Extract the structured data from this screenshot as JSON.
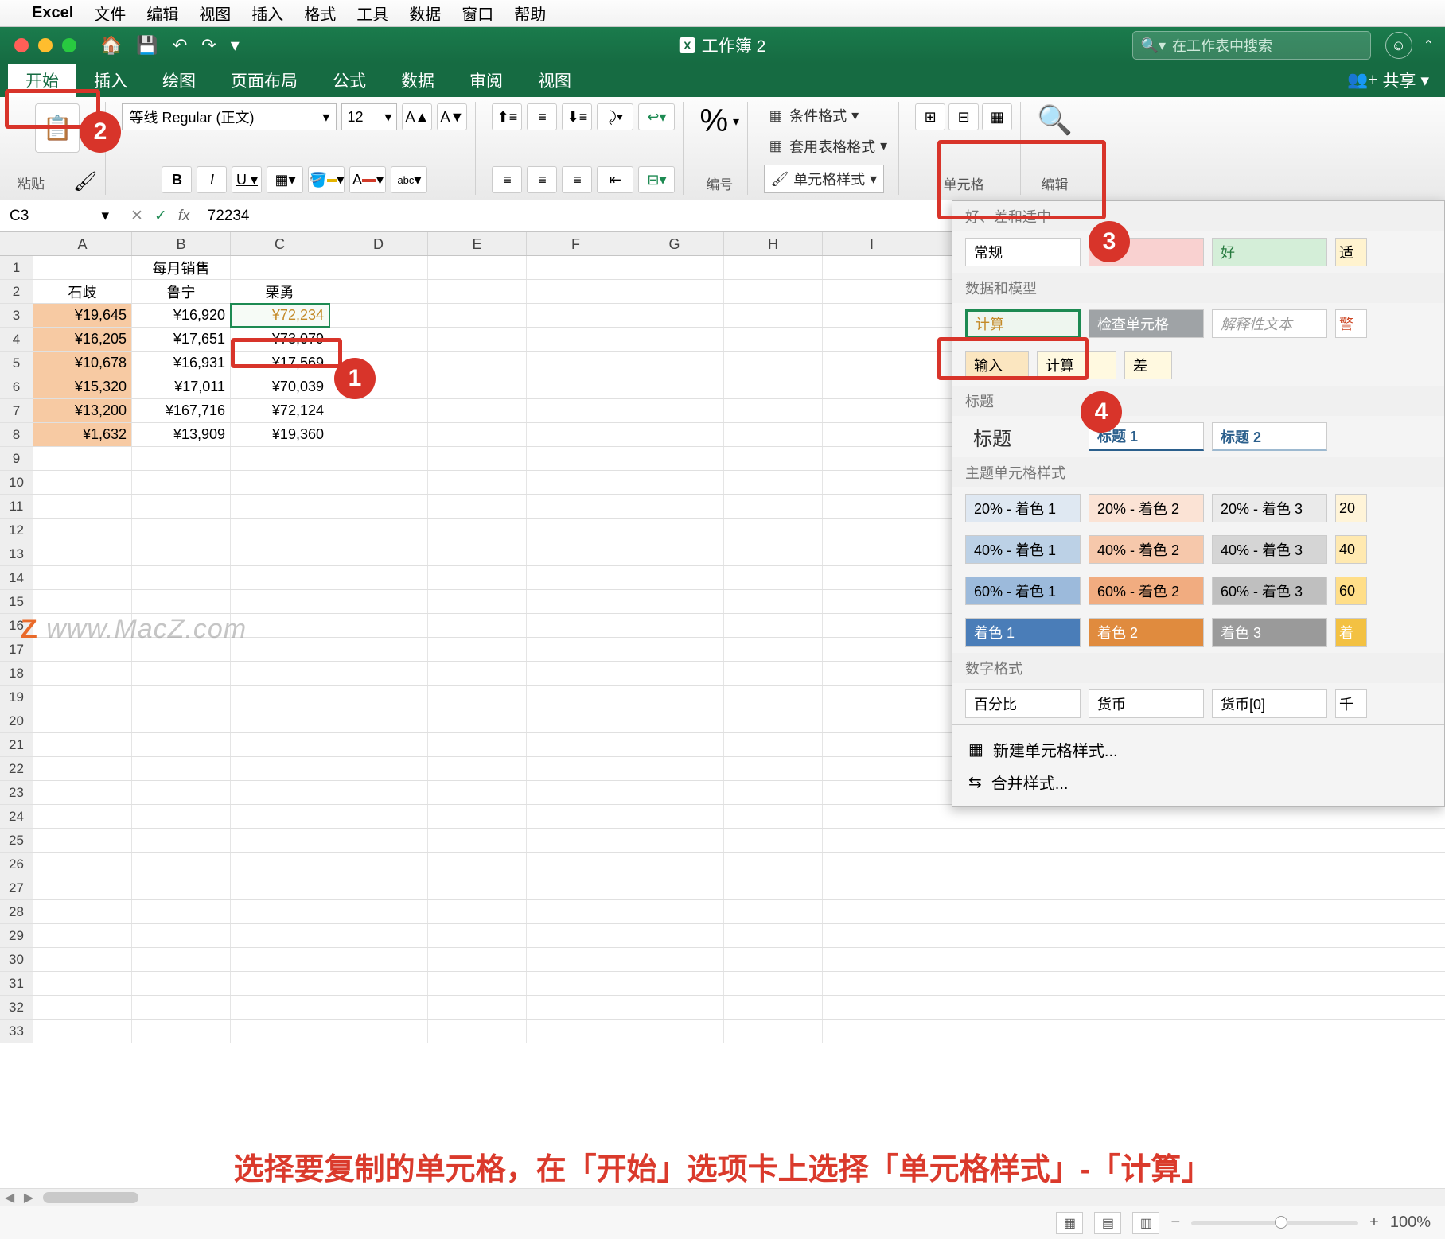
{
  "mac_menu": {
    "app": "Excel",
    "items": [
      "文件",
      "编辑",
      "视图",
      "插入",
      "格式",
      "工具",
      "数据",
      "窗口",
      "帮助"
    ]
  },
  "titlebar": {
    "doc": "工作簿 2",
    "search_placeholder": "在工作表中搜索"
  },
  "ribbon_tabs": {
    "items": [
      "开始",
      "插入",
      "绘图",
      "页面布局",
      "公式",
      "数据",
      "审阅",
      "视图"
    ],
    "active": 0,
    "share": "共享"
  },
  "ribbon": {
    "paste": "粘贴",
    "font_name": "等线 Regular (正文)",
    "font_size": "12",
    "number_label": "编号",
    "cond_fmt": "条件格式",
    "table_fmt": "套用表格格式",
    "cell_style": "单元格样式",
    "cells_label": "单元格",
    "edit_label": "编辑"
  },
  "fbar": {
    "name": "C3",
    "value": "72234"
  },
  "columns": [
    "A",
    "B",
    "C",
    "D",
    "E",
    "F",
    "G",
    "H",
    "I"
  ],
  "sheet": {
    "title_row": "每月销售",
    "headers": [
      "石歧",
      "鲁宁",
      "栗勇"
    ],
    "rows": [
      [
        "¥19,645",
        "¥16,920",
        "¥72,234"
      ],
      [
        "¥16,205",
        "¥17,651",
        "¥73,079"
      ],
      [
        "¥10,678",
        "¥16,931",
        "¥17,569"
      ],
      [
        "¥15,320",
        "¥17,011",
        "¥70,039"
      ],
      [
        "¥13,200",
        "¥167,716",
        "¥72,124"
      ],
      [
        "¥1,632",
        "¥13,909",
        "¥19,360"
      ]
    ]
  },
  "styles_panel": {
    "s1": "好、差和适中",
    "r1": [
      "常规",
      "差",
      "好",
      "适"
    ],
    "s2": "数据和模型",
    "r2": [
      "计算",
      "检查单元格",
      "解释性文本",
      "警"
    ],
    "r2b": [
      "输入",
      "计算",
      "差"
    ],
    "s3": "标题",
    "r3": [
      "标题",
      "标题 1",
      "标题 2"
    ],
    "s4": "主题单元格样式",
    "r4": [
      "20% - 着色 1",
      "20% - 着色 2",
      "20% - 着色 3",
      "20"
    ],
    "r5": [
      "40% - 着色 1",
      "40% - 着色 2",
      "40% - 着色 3",
      "40"
    ],
    "r6": [
      "60% - 着色 1",
      "60% - 着色 2",
      "60% - 着色 3",
      "60"
    ],
    "r7": [
      "着色 1",
      "着色 2",
      "着色 3",
      "着"
    ],
    "s5": "数字格式",
    "r8": [
      "百分比",
      "货币",
      "货币[0]",
      "千"
    ],
    "new_style": "新建单元格样式...",
    "merge_style": "合并样式..."
  },
  "caption": "选择要复制的单元格，在「开始」选项卡上选择「单元格样式」-「计算」",
  "status": {
    "zoom": "100%"
  },
  "watermark": "www.MacZ.com"
}
